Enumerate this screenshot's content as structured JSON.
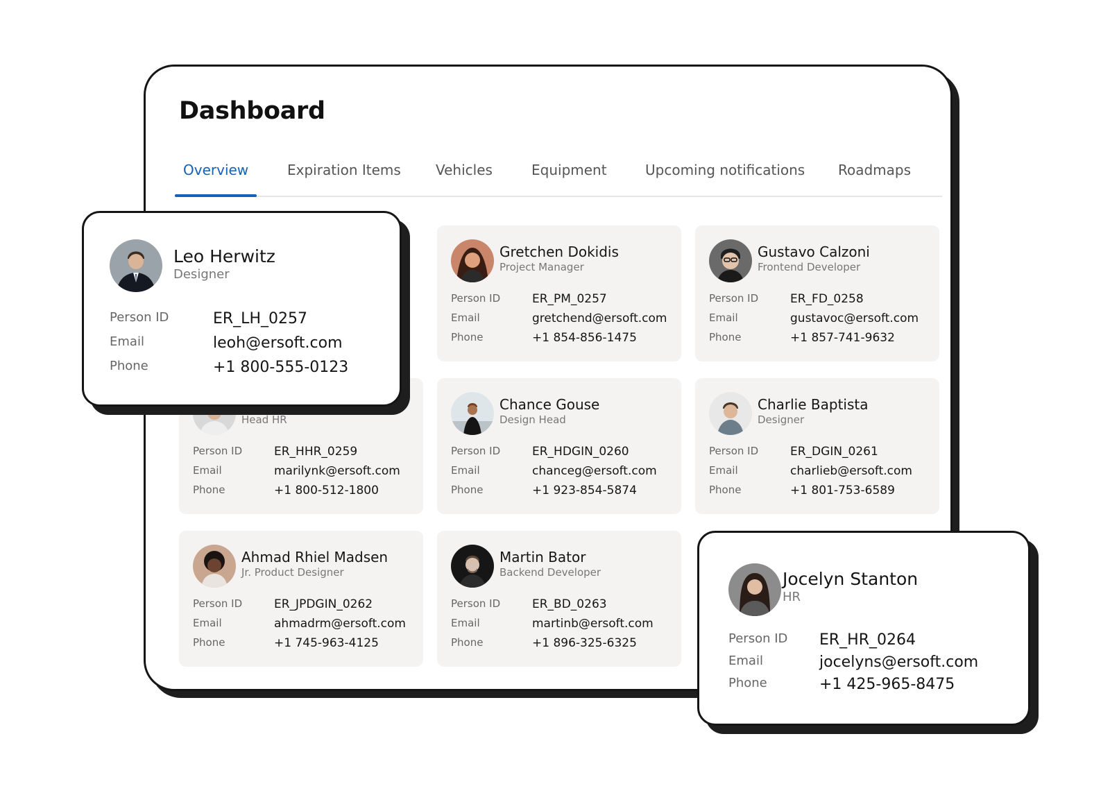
{
  "page": {
    "title": "Dashboard"
  },
  "tabs": [
    {
      "label": "Overview",
      "active": true
    },
    {
      "label": "Expiration Items"
    },
    {
      "label": "Vehicles"
    },
    {
      "label": "Equipment"
    },
    {
      "label": "Upcoming notifications"
    },
    {
      "label": "Roadmaps"
    }
  ],
  "field_labels": {
    "person_id": "Person ID",
    "email": "Email",
    "phone": "Phone"
  },
  "colors": {
    "accent": "#1560b8",
    "card_bg": "#f4f3f2",
    "border": "#151515"
  },
  "popups": {
    "leo": {
      "name": "Leo Herwitz",
      "role": "Designer",
      "person_id": "ER_LH_0257",
      "email": "leoh@ersoft.com",
      "phone": "+1 800-555-0123"
    },
    "jocelyn": {
      "name": "Jocelyn Stanton",
      "role": "HR",
      "person_id": "ER_HR_0264",
      "email": "jocelyns@ersoft.com",
      "phone": "+1 425-965-8475"
    }
  },
  "people": [
    {
      "name": "Gretchen Dokidis",
      "role": "Project Manager",
      "person_id": "ER_PM_0257",
      "email": "gretchend@ersoft.com",
      "phone": "+1 854-856-1475"
    },
    {
      "name": "Gustavo Calzoni",
      "role": "Frontend Developer",
      "person_id": "ER_FD_0258",
      "email": "gustavoc@ersoft.com",
      "phone": "+1 857-741-9632"
    },
    {
      "name": "",
      "role": "Head HR",
      "person_id": "ER_HHR_0259",
      "email": "marilynk@ersoft.com",
      "phone": "+1 800-512-1800"
    },
    {
      "name": "Chance Gouse",
      "role": "Design Head",
      "person_id": "ER_HDGIN_0260",
      "email": "chanceg@ersoft.com",
      "phone": "+1 923-854-5874"
    },
    {
      "name": "Charlie Baptista",
      "role": "Designer",
      "person_id": "ER_DGIN_0261",
      "email": "charlieb@ersoft.com",
      "phone": "+1 801-753-6589"
    },
    {
      "name": "Ahmad Rhiel Madsen",
      "role": "Jr. Product Designer",
      "person_id": "ER_JPDGIN_0262",
      "email": "ahmadrm@ersoft.com",
      "phone": "+1 745-963-4125"
    },
    {
      "name": "Martin Bator",
      "role": "Backend Developer",
      "person_id": "ER_BD_0263",
      "email": "martinb@ersoft.com",
      "phone": "+1 896-325-6325"
    }
  ]
}
